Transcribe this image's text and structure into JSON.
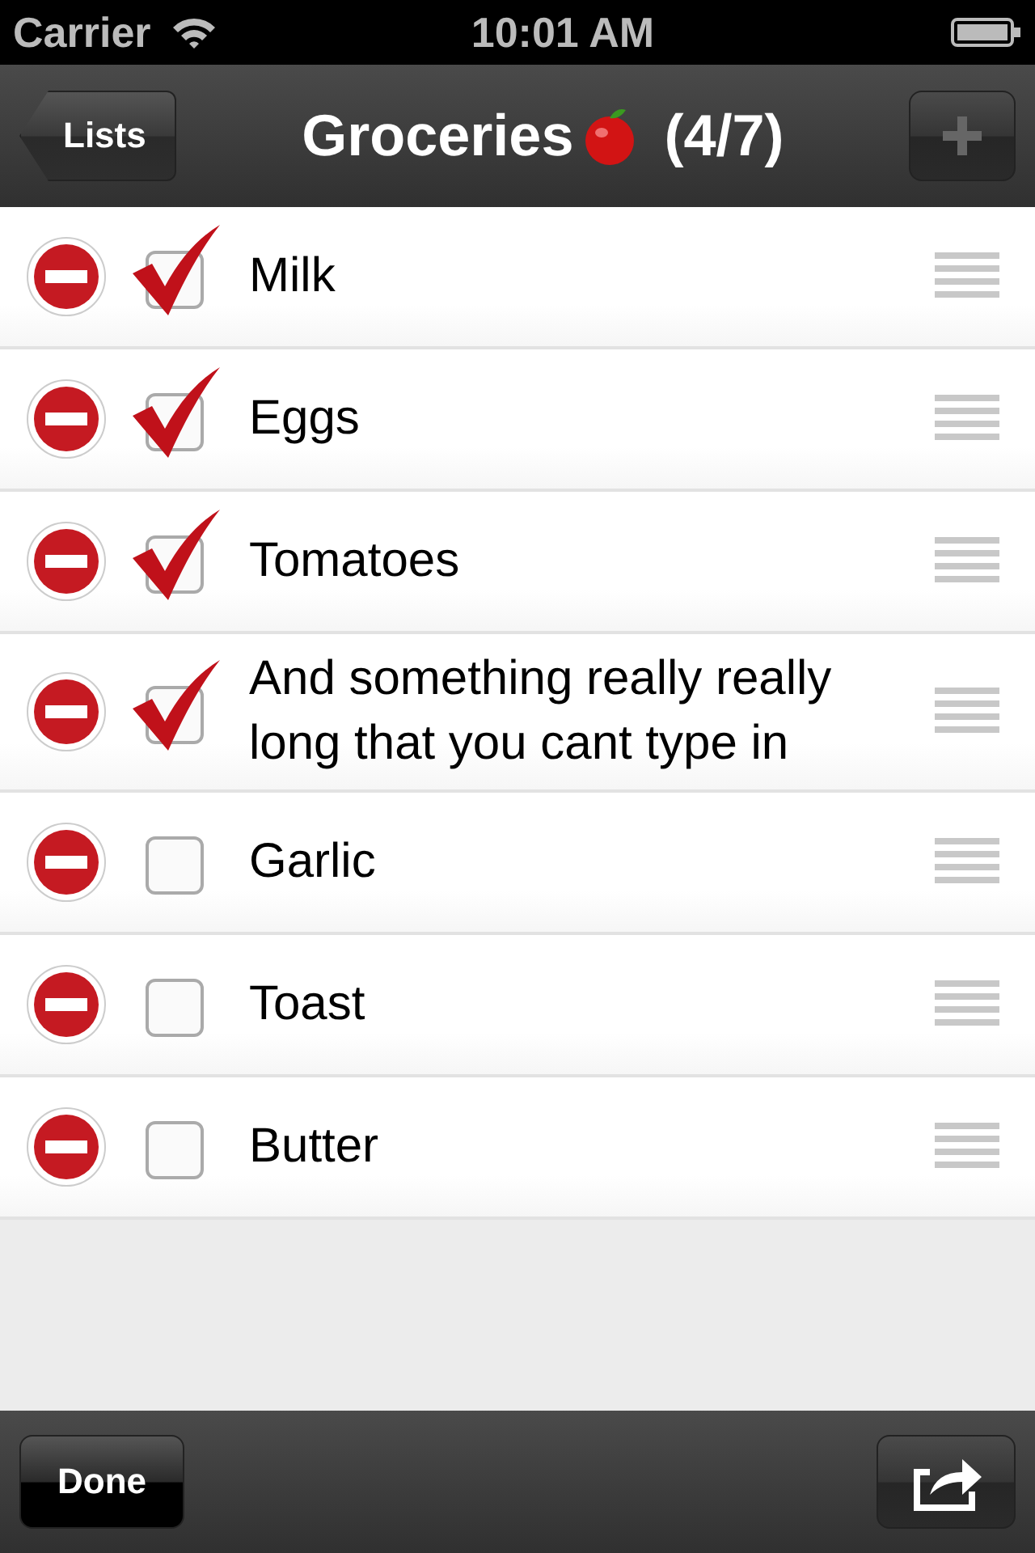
{
  "status_bar": {
    "carrier": "Carrier",
    "time": "10:01 AM"
  },
  "nav_bar": {
    "back": "Lists",
    "title": "Groceries",
    "count": "(4/7)"
  },
  "items": [
    {
      "text": "Milk",
      "checked": true
    },
    {
      "text": "Eggs",
      "checked": true
    },
    {
      "text": "Tomatoes",
      "checked": true
    },
    {
      "text": "And something really really long that you cant type in",
      "checked": true
    },
    {
      "text": "Garlic",
      "checked": false
    },
    {
      "text": "Toast",
      "checked": false
    },
    {
      "text": "Butter",
      "checked": false
    }
  ],
  "toolbar": {
    "done": "Done"
  }
}
